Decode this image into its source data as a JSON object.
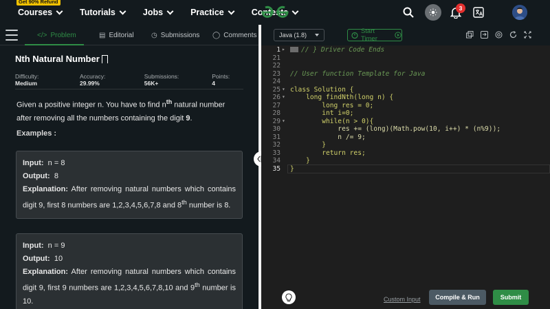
{
  "nav": {
    "refund_badge": "Get 90% Refund",
    "items": [
      {
        "label": "Courses"
      },
      {
        "label": "Tutorials"
      },
      {
        "label": "Jobs"
      },
      {
        "label": "Practice"
      },
      {
        "label": "Contests"
      }
    ],
    "notification_count": "3",
    "logo_icon": "gfg-logo-icon",
    "accent": "#2f8d46",
    "badge_color": "#e3302f"
  },
  "tabs": [
    {
      "label": "Problem",
      "icon": "code-icon"
    },
    {
      "label": "Editorial",
      "icon": "document-icon"
    },
    {
      "label": "Submissions",
      "icon": "clock-icon"
    },
    {
      "label": "Comments",
      "icon": "comment-icon"
    }
  ],
  "problem": {
    "title": "Nth Natural Number",
    "difficulty_label": "Difficulty:",
    "difficulty": "Medium",
    "accuracy_label": "Accuracy:",
    "accuracy": "29.99%",
    "submissions_label": "Submissions:",
    "submissions": "56K+",
    "points_label": "Points:",
    "points": "4",
    "desc_1": "Given a positive integer n. You have to find n",
    "desc_sup": "th",
    "desc_2": " natural number after removing all the numbers containing the digit ",
    "desc_digit": "9",
    "desc_end": ".",
    "examples_heading": "Examples :",
    "examples": [
      {
        "input_label": "Input:",
        "input": "n = 8",
        "output_label": "Output:",
        "output": "8",
        "expl_label": "Explanation:",
        "expl": "After removing natural numbers which contains digit 9, first 8 numbers are 1,2,3,4,5,6,7,8 and 8",
        "expl_sup": "th",
        "expl_end": " number is 8."
      },
      {
        "input_label": "Input:",
        "input": "n = 9",
        "output_label": "Output:",
        "output": "10",
        "expl_label": "Explanation:",
        "expl": "After removing natural numbers which contains digit 9, first 9 numbers are 1,2,3,4,5,6,7,8,10 and 9",
        "expl_sup": "th",
        "expl_end": " number is 10."
      }
    ]
  },
  "editor": {
    "language": "Java (1.8)",
    "timer_label": "Start Timer",
    "custom_input": "Custom Input",
    "compile_run": "Compile & Run",
    "submit": "Submit",
    "lines": [
      {
        "n": "1",
        "text": "// } Driver Code Ends"
      },
      {
        "n": "21",
        "text": ""
      },
      {
        "n": "22",
        "text": ""
      },
      {
        "n": "23",
        "text": "// User function Template for Java"
      },
      {
        "n": "24",
        "text": ""
      },
      {
        "n": "25",
        "text": "class Solution {"
      },
      {
        "n": "26",
        "text": "    long findNth(long n) {"
      },
      {
        "n": "27",
        "text": "        long res = 0;"
      },
      {
        "n": "28",
        "text": "        int i=0;"
      },
      {
        "n": "29",
        "text": "        while(n > 0){"
      },
      {
        "n": "30",
        "text": "            res += (long)(Math.pow(10, i++) * (n%9));"
      },
      {
        "n": "31",
        "text": "            n /= 9;"
      },
      {
        "n": "32",
        "text": "        }"
      },
      {
        "n": "33",
        "text": "        return res;"
      },
      {
        "n": "34",
        "text": "    }"
      },
      {
        "n": "35",
        "text": "}"
      }
    ]
  }
}
